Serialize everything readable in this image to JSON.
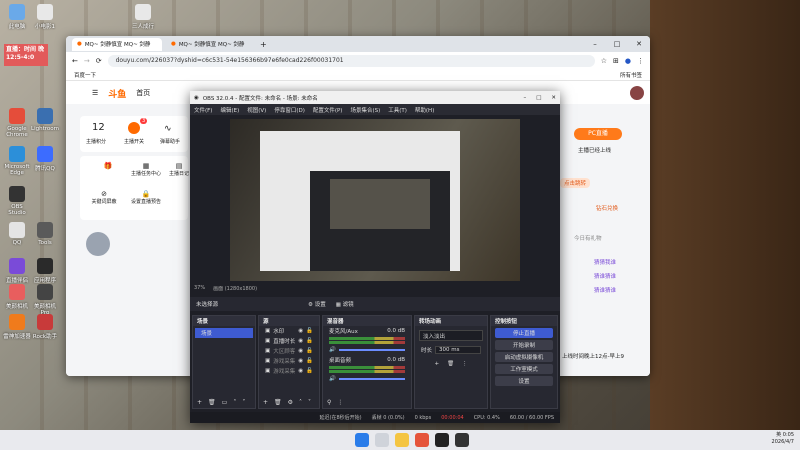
{
  "desktop": {
    "icons": [
      {
        "label": "此电脑",
        "color": "#6aa9e9"
      },
      {
        "label": "小电影1",
        "color": "#e8e8e8"
      },
      {
        "label": "三人成行",
        "color": "#e8e8e8"
      },
      {
        "label": "Google Chrome",
        "color": "#e54d3a"
      },
      {
        "label": "Lightroom",
        "color": "#3a6fb0"
      },
      {
        "label": "Microsoft Edge",
        "color": "#2c8fd9"
      },
      {
        "label": "腾讯QQ",
        "color": "#3c6cff"
      },
      {
        "label": "OBS Studio",
        "color": "#333333"
      },
      {
        "label": "QQ",
        "color": "#e4e4e4"
      },
      {
        "label": "Tools",
        "color": "#5a5a5a"
      },
      {
        "label": "直播伴侣",
        "color": "#7a4bd8"
      },
      {
        "label": "应用程序",
        "color": "#2a2a2a"
      },
      {
        "label": "美颜相机",
        "color": "#e85e5e"
      },
      {
        "label": "美颜相机 Pro",
        "color": "#444444"
      },
      {
        "label": "雷神加速器",
        "color": "#f07b1c"
      },
      {
        "label": "Rock助手",
        "color": "#c83a3a"
      }
    ],
    "sticky_note": "直播：时间 晚12:5-4:0"
  },
  "browser": {
    "tabs": [
      "MQ~ 剑静慎宣 MQ~ 剑静",
      "MQ~ 剑静慎宣 MQ~ 剑静"
    ],
    "url": "douyu.com/226037?dyshid=c6c531-54e156366b97e6fe0cad226f00031701",
    "bookmark": "百度一下",
    "bookmark_right": "所有书签",
    "site": {
      "logo": "斗鱼",
      "nav_home": "首页",
      "stats": [
        {
          "value": "12",
          "label": "主播积分"
        },
        {
          "value": "3",
          "label": "主播开关"
        },
        {
          "value": "",
          "label": "弹幕助手"
        }
      ],
      "grid_items": [
        "主播任务中心",
        "主播日记",
        "关键词屏蔽",
        "设置直播预告",
        "PC直播"
      ],
      "pc_live_btn": "PC直播",
      "right_lines": [
        "主播主页",
        "主播已经上线",
        "点击跳转",
        "钻石兑换",
        "今日有礼物",
        "猜猜我谁",
        "猜谁猜谁",
        "猜谁猜谁",
        "主播时间",
        "上线时间晚上12点-早上9"
      ]
    }
  },
  "obs": {
    "title": "OBS 32.0.4 - 配置文件: 未命名 - 场景: 未命名",
    "menu": [
      "文件(F)",
      "编辑(E)",
      "视图(V)",
      "停靠窗口(D)",
      "配置文件(P)",
      "场景集合(S)",
      "工具(T)",
      "帮助(H)"
    ],
    "zoom": "37%",
    "canvas": "画面 (1280x1800)",
    "no_source": "未选择源",
    "props_btn": "设置",
    "filter_btn": "滤镜",
    "docks": {
      "scenes": {
        "title": "场景",
        "items": [
          "场景"
        ]
      },
      "sources": {
        "title": "源",
        "items": [
          "水印",
          "直播时长",
          "大区顾客",
          "游戏采集",
          "游戏采集"
        ]
      },
      "mixer": {
        "title": "混音器",
        "channels": [
          {
            "name": "麦克风/Aux",
            "db": "0.0 dB"
          },
          {
            "name": "桌面音频",
            "db": "0.0 dB"
          }
        ]
      },
      "transitions": {
        "title": "转场动画",
        "type": "淡入淡出",
        "duration_label": "时长",
        "duration": "300 ms"
      },
      "controls": {
        "title": "控制按钮",
        "buttons": [
          "停止直播",
          "开始录制",
          "启动虚拟摄像机",
          "工作室模式",
          "设置"
        ]
      }
    },
    "status": {
      "delay": "延迟(在8秒后开始)",
      "dropped": "丢帧 0 (0.0%)",
      "kbps": "0 kbps",
      "time": "00:00:04",
      "cpu": "CPU: 0.4%",
      "fps": "60.00 / 60.00 FPS"
    }
  },
  "taskbar": {
    "lang": "英",
    "time": "0:05",
    "date": "2026/4/7"
  }
}
